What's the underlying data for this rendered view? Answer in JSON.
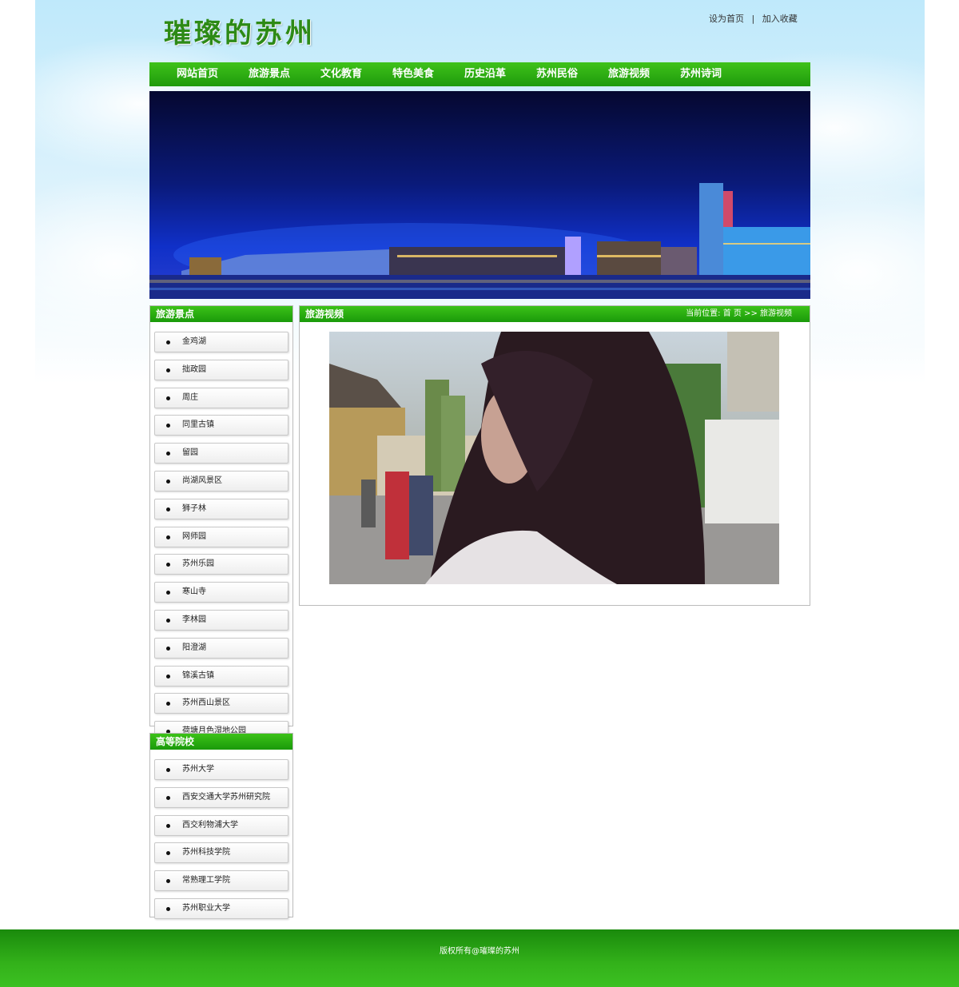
{
  "header": {
    "logo": "璀璨的苏州",
    "top_links": [
      "设为首页",
      "加入收藏"
    ],
    "separator": "|"
  },
  "nav": {
    "items": [
      "网站首页",
      "旅游景点",
      "文化教育",
      "特色美食",
      "历史沿革",
      "苏州民俗",
      "旅游视频",
      "苏州诗词"
    ]
  },
  "sidebar": {
    "scenic": {
      "title": "旅游景点",
      "items": [
        "金鸡湖",
        "拙政园",
        "周庄",
        "同里古镇",
        "留园",
        "尚湖风景区",
        "狮子林",
        "网师园",
        "苏州乐园",
        "寒山寺",
        "李林园",
        "阳澄湖",
        "锦溪古镇",
        "苏州西山景区",
        "荷塘月色湿地公园"
      ]
    },
    "colleges": {
      "title": "高等院校",
      "items": [
        "苏州大学",
        "西安交通大学苏州研究院",
        "西交利物浦大学",
        "苏州科技学院",
        "常熟理工学院",
        "苏州职业大学"
      ]
    }
  },
  "main": {
    "title": "旅游视频",
    "breadcrumb": "当前位置: 首 页 >> 旅游视频"
  },
  "footer": {
    "copyright": "版权所有@璀璨的苏州"
  },
  "colors": {
    "nav_green": "#1e9a0c",
    "header_green": "#3cc218",
    "logo_green": "#2d8a16"
  }
}
